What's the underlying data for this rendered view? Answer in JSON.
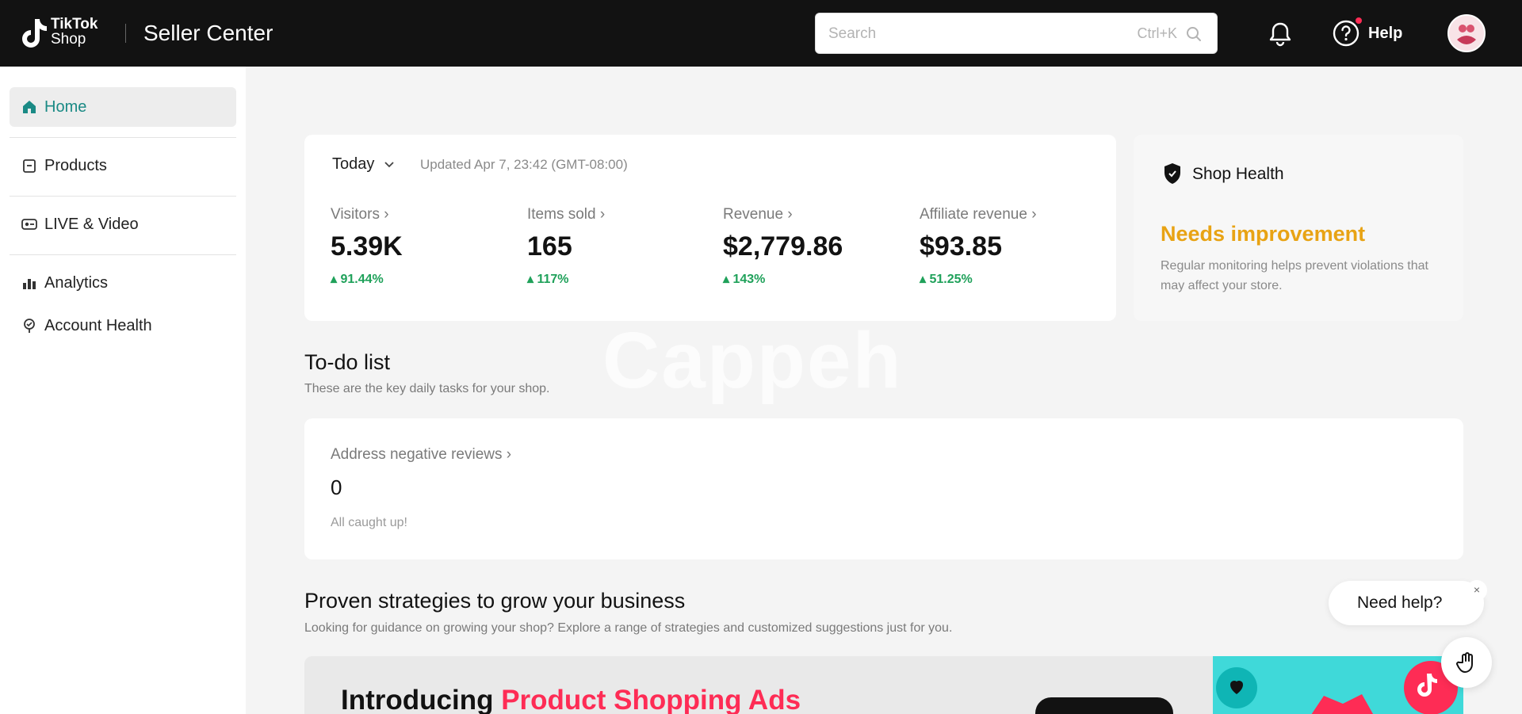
{
  "header": {
    "brand_line1": "TikTok",
    "brand_line2": "Shop",
    "app_title": "Seller Center",
    "search_placeholder": "Search",
    "search_shortcut": "Ctrl+K",
    "help_label": "Help",
    "colors": {
      "bar": "#121212",
      "notification_dot": "#fe2c55"
    }
  },
  "sidebar": {
    "items": [
      {
        "label": "Home",
        "icon": "home-icon",
        "active": true
      },
      {
        "label": "Products",
        "icon": "products-icon",
        "active": false
      },
      {
        "label": "LIVE & Video",
        "icon": "live-video-icon",
        "active": false
      },
      {
        "label": "Analytics",
        "icon": "analytics-icon",
        "active": false
      },
      {
        "label": "Account Health",
        "icon": "account-health-icon",
        "active": false
      }
    ],
    "active_color": "#1a8a85"
  },
  "overview": {
    "period": "Today",
    "updated": "Updated Apr 7, 23:42 (GMT-08:00)",
    "metrics": [
      {
        "label": "Visitors",
        "value": "5.39K",
        "delta": "91.44%"
      },
      {
        "label": "Items sold",
        "value": "165",
        "delta": "117%"
      },
      {
        "label": "Revenue",
        "value": "$2,779.86",
        "delta": "143%"
      },
      {
        "label": "Affiliate revenue",
        "value": "$93.85",
        "delta": "51.25%"
      }
    ],
    "delta_color": "#1fa15a"
  },
  "shop_health": {
    "title": "Shop Health",
    "status": "Needs improvement",
    "description": "Regular monitoring helps prevent violations that may affect your store.",
    "status_color": "#e8a314"
  },
  "todo": {
    "title": "To-do list",
    "subtitle": "These are the key daily tasks for your shop.",
    "item_label": "Address negative reviews",
    "item_value": "0",
    "item_note": "All caught up!"
  },
  "strategies": {
    "title": "Proven strategies to grow your business",
    "subtitle": "Looking for guidance on growing your shop? Explore a range of strategies and customized suggestions just for you.",
    "banner_prefix": "Introducing ",
    "banner_accent": "Product Shopping Ads",
    "accent_color": "#fe2c55"
  },
  "watermark": "Cappeh",
  "chat": {
    "label": "Need help?",
    "close": "×"
  }
}
